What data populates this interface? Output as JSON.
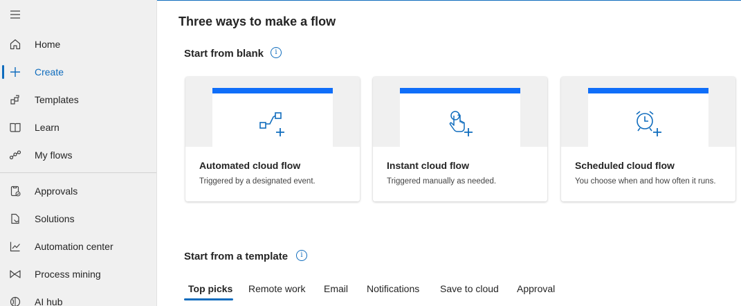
{
  "sidebar": {
    "menu_icon": "hamburger-icon",
    "items": [
      {
        "label": "Home",
        "icon": "home-icon"
      },
      {
        "label": "Create",
        "icon": "plus-icon"
      },
      {
        "label": "Templates",
        "icon": "templates-icon"
      },
      {
        "label": "Learn",
        "icon": "book-icon"
      },
      {
        "label": "My flows",
        "icon": "flow-icon"
      },
      {
        "label": "Approvals",
        "icon": "approvals-icon"
      },
      {
        "label": "Solutions",
        "icon": "solutions-icon"
      },
      {
        "label": "Automation center",
        "icon": "chart-line-icon"
      },
      {
        "label": "Process mining",
        "icon": "process-mining-icon"
      },
      {
        "label": "AI hub",
        "icon": "ai-hub-icon"
      }
    ],
    "active_item": "Create"
  },
  "main": {
    "page_title": "Three ways to make a flow",
    "blank_section": {
      "title": "Start from blank",
      "cards": [
        {
          "title": "Automated cloud flow",
          "description": "Triggered by a designated event.",
          "icon": "automated-flow-icon"
        },
        {
          "title": "Instant cloud flow",
          "description": "Triggered manually as needed.",
          "icon": "touch-hand-icon"
        },
        {
          "title": "Scheduled cloud flow",
          "description": "You choose when and how often it runs.",
          "icon": "alarm-clock-icon"
        }
      ]
    },
    "template_section": {
      "title": "Start from a template",
      "tabs": [
        "Top picks",
        "Remote work",
        "Email",
        "Notifications",
        "Save to cloud",
        "Approval"
      ],
      "selected_tab": "Top picks"
    }
  },
  "colors": {
    "accent": "#0f6cbd",
    "card_bar": "#0f6ef9",
    "sidebar_bg": "#f0f0f0"
  }
}
